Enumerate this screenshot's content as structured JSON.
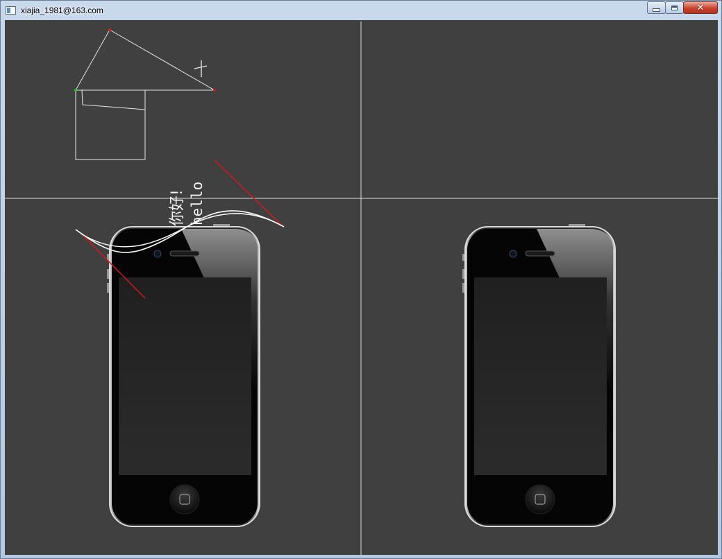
{
  "window": {
    "title": "xiajia_1981@163.com",
    "controls": {
      "minimize": "–",
      "maximize": "□",
      "close": "✕"
    }
  },
  "canvas": {
    "background_color": "#404040",
    "divider_color": "#dcdcdc",
    "text_labels": {
      "chinese": "你好!",
      "english": "hello"
    },
    "accent_colors": {
      "red_line": "#d11a1a",
      "green_point": "#22cc22",
      "white_stroke": "#e8e8e8"
    }
  },
  "panels": [
    {
      "name": "top-left",
      "content": "vector drawing"
    },
    {
      "name": "top-right",
      "content": "empty"
    },
    {
      "name": "bottom-left",
      "content": "iphone image"
    },
    {
      "name": "bottom-right",
      "content": "iphone image"
    }
  ]
}
